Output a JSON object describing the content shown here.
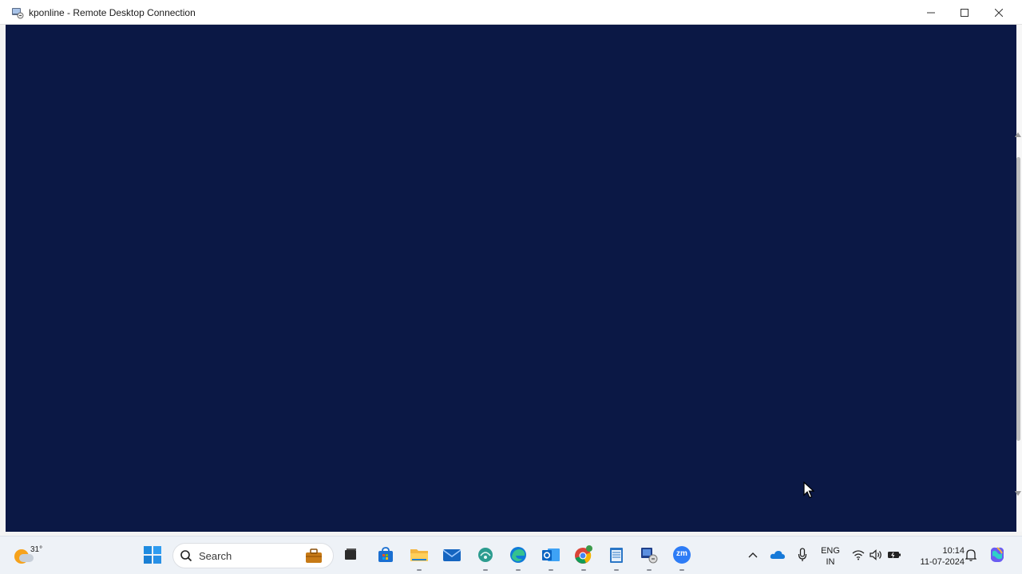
{
  "window": {
    "title": "kponline - Remote Desktop Connection",
    "remote_bg_color": "#0b1845",
    "controls": {
      "minimize": "minimize-icon",
      "maximize": "maximize-icon",
      "close": "close-icon"
    }
  },
  "taskbar": {
    "weather": {
      "temp": "31°",
      "icon": "weather-sun-cloud-icon"
    },
    "start_icon": "windows-start-icon",
    "search": {
      "placeholder": "Search"
    },
    "apps": [
      {
        "name": "task-view-icon"
      },
      {
        "name": "microsoft-store-icon"
      },
      {
        "name": "file-explorer-icon"
      },
      {
        "name": "mail-icon"
      },
      {
        "name": "settings-network-icon"
      },
      {
        "name": "edge-browser-icon"
      },
      {
        "name": "outlook-icon"
      },
      {
        "name": "chrome-icon"
      },
      {
        "name": "notepad-icon"
      },
      {
        "name": "remote-desktop-icon"
      },
      {
        "name": "zoom-icon",
        "label": "zm"
      }
    ],
    "tray": {
      "language_line1": "ENG",
      "language_line2": "IN",
      "time": "10:14",
      "date": "11-07-2024"
    }
  }
}
